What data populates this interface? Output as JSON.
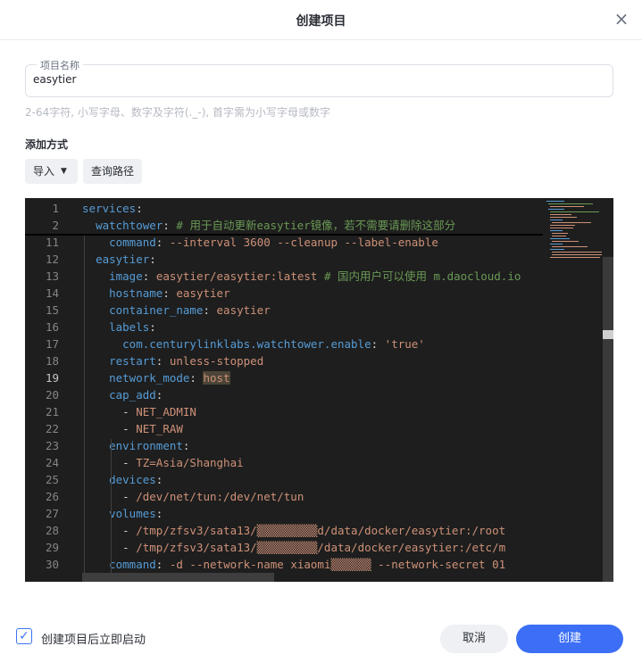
{
  "dialog": {
    "title": "创建项目",
    "close_icon": "×"
  },
  "project_name": {
    "label": "项目名称",
    "value": "easytier",
    "hint": "2-64字符, 小写字母、数字及字符(._-), 首字需为小写字母或数字"
  },
  "add_method": {
    "label": "添加方式",
    "import_label": "导入",
    "import_caret": "▼",
    "query_path_label": "查询路径"
  },
  "editor": {
    "active_line": 19,
    "lines": [
      {
        "n": "1",
        "parts": [
          [
            "k",
            "services"
          ],
          [
            "p",
            ":"
          ]
        ]
      },
      {
        "n": "2",
        "parts": [
          [
            "p",
            "  "
          ],
          [
            "k",
            "watchtower"
          ],
          [
            "p",
            ": "
          ],
          [
            "c",
            "# 用于自动更新easytier镜像，若不需要请删除这部分"
          ]
        ]
      },
      {
        "n": "11",
        "parts": [
          [
            "p",
            "    "
          ],
          [
            "k",
            "command"
          ],
          [
            "p",
            ": "
          ],
          [
            "v",
            "--interval 3600 --cleanup --label-enable"
          ]
        ]
      },
      {
        "n": "12",
        "parts": [
          [
            "p",
            "  "
          ],
          [
            "k",
            "easytier"
          ],
          [
            "p",
            ":"
          ]
        ]
      },
      {
        "n": "13",
        "parts": [
          [
            "p",
            "    "
          ],
          [
            "k",
            "image"
          ],
          [
            "p",
            ": "
          ],
          [
            "v",
            "easytier/easytier:latest"
          ],
          [
            "p",
            " "
          ],
          [
            "c",
            "# 国内用户可以使用 m.daocloud.io"
          ]
        ]
      },
      {
        "n": "14",
        "parts": [
          [
            "p",
            "    "
          ],
          [
            "k",
            "hostname"
          ],
          [
            "p",
            ": "
          ],
          [
            "v",
            "easytier"
          ]
        ]
      },
      {
        "n": "15",
        "parts": [
          [
            "p",
            "    "
          ],
          [
            "k",
            "container_name"
          ],
          [
            "p",
            ": "
          ],
          [
            "v",
            "easytier"
          ]
        ]
      },
      {
        "n": "16",
        "parts": [
          [
            "p",
            "    "
          ],
          [
            "k",
            "labels"
          ],
          [
            "p",
            ":"
          ]
        ]
      },
      {
        "n": "17",
        "parts": [
          [
            "p",
            "      "
          ],
          [
            "k",
            "com.centurylinklabs.watchtower.enable"
          ],
          [
            "p",
            ": "
          ],
          [
            "v",
            "'true'"
          ]
        ]
      },
      {
        "n": "18",
        "parts": [
          [
            "p",
            "    "
          ],
          [
            "k",
            "restart"
          ],
          [
            "p",
            ": "
          ],
          [
            "v",
            "unless-stopped"
          ]
        ]
      },
      {
        "n": "19",
        "parts": [
          [
            "p",
            "    "
          ],
          [
            "k",
            "network_mode"
          ],
          [
            "p",
            ": "
          ],
          [
            "vh",
            "host"
          ]
        ]
      },
      {
        "n": "20",
        "parts": [
          [
            "p",
            "    "
          ],
          [
            "k",
            "cap_add"
          ],
          [
            "p",
            ":"
          ]
        ]
      },
      {
        "n": "21",
        "parts": [
          [
            "p",
            "      - "
          ],
          [
            "v",
            "NET_ADMIN"
          ]
        ]
      },
      {
        "n": "22",
        "parts": [
          [
            "p",
            "      - "
          ],
          [
            "v",
            "NET_RAW"
          ]
        ]
      },
      {
        "n": "23",
        "parts": [
          [
            "p",
            "    "
          ],
          [
            "k",
            "environment"
          ],
          [
            "p",
            ":"
          ]
        ]
      },
      {
        "n": "24",
        "parts": [
          [
            "p",
            "      - "
          ],
          [
            "v",
            "TZ=Asia/Shanghai"
          ]
        ]
      },
      {
        "n": "25",
        "parts": [
          [
            "p",
            "    "
          ],
          [
            "k",
            "devices"
          ],
          [
            "p",
            ":"
          ]
        ]
      },
      {
        "n": "26",
        "parts": [
          [
            "p",
            "      - "
          ],
          [
            "v",
            "/dev/net/tun:/dev/net/tun"
          ]
        ]
      },
      {
        "n": "27",
        "parts": [
          [
            "p",
            "    "
          ],
          [
            "k",
            "volumes"
          ],
          [
            "p",
            ":"
          ]
        ]
      },
      {
        "n": "28",
        "parts": [
          [
            "p",
            "      - "
          ],
          [
            "v",
            "/tmp/zfsv3/sata13/▒▒▒▒▒▒▒▒▒d/data/docker/easytier:/root"
          ]
        ]
      },
      {
        "n": "29",
        "parts": [
          [
            "p",
            "      - "
          ],
          [
            "v",
            "/tmp/zfsv3/sata13/▒▒▒▒▒▒▒▒▒/data/docker/easytier:/etc/m"
          ]
        ]
      },
      {
        "n": "30",
        "parts": [
          [
            "p",
            "    "
          ],
          [
            "k",
            "command"
          ],
          [
            "p",
            ": "
          ],
          [
            "v",
            "-d --network-name xiaomi▒▒▒▒▒▒ --network-secret 01"
          ]
        ]
      }
    ]
  },
  "footer": {
    "auto_start_label": "创建项目后立即启动",
    "auto_start_checked": true,
    "check_mark": "✓",
    "cancel_label": "取消",
    "create_label": "创建"
  },
  "colors": {
    "accent": "#3c6ff5",
    "editor_bg": "#1e1e1e",
    "key": "#569cd6",
    "string": "#ce9178",
    "comment": "#6a9955"
  }
}
